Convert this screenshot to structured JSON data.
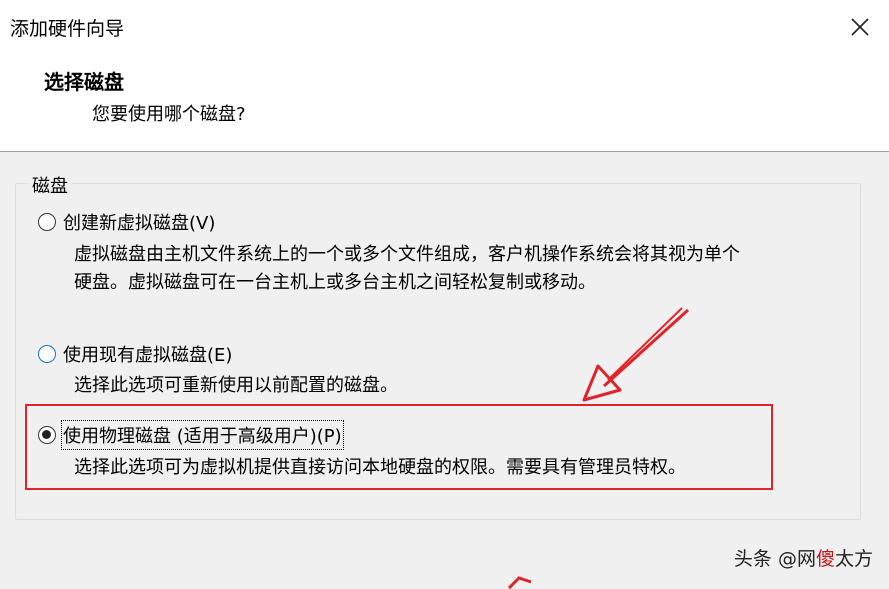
{
  "window": {
    "title": "添加硬件向导"
  },
  "header": {
    "title": "选择磁盘",
    "subtitle": "您要使用哪个磁盘?"
  },
  "group": {
    "legend": "磁盘",
    "options": [
      {
        "label": "创建新虚拟磁盘(V)",
        "selected": false,
        "description_lines": [
          "虚拟磁盘由主机文件系统上的一个或多个文件组成，客户机操作系统会将其视为单个",
          "硬盘。虚拟磁盘可在一台主机上或多台主机之间轻松复制或移动。"
        ]
      },
      {
        "label": "使用现有虚拟磁盘(E)",
        "selected": false,
        "description_lines": [
          "选择此选项可重新使用以前配置的磁盘。"
        ]
      },
      {
        "label": "使用物理磁盘 (适用于高级用户)(P)",
        "selected": true,
        "description_lines": [
          "选择此选项可为虚拟机提供直接访问本地硬盘的权限。需要具有管理员特权。"
        ]
      }
    ]
  },
  "overlay": {
    "annotation_color": "#e0242b",
    "watermark_prefix": "头条 @网",
    "watermark_accent": "傻",
    "watermark_suffix": "太方"
  },
  "icons": {
    "close": "close-icon"
  }
}
